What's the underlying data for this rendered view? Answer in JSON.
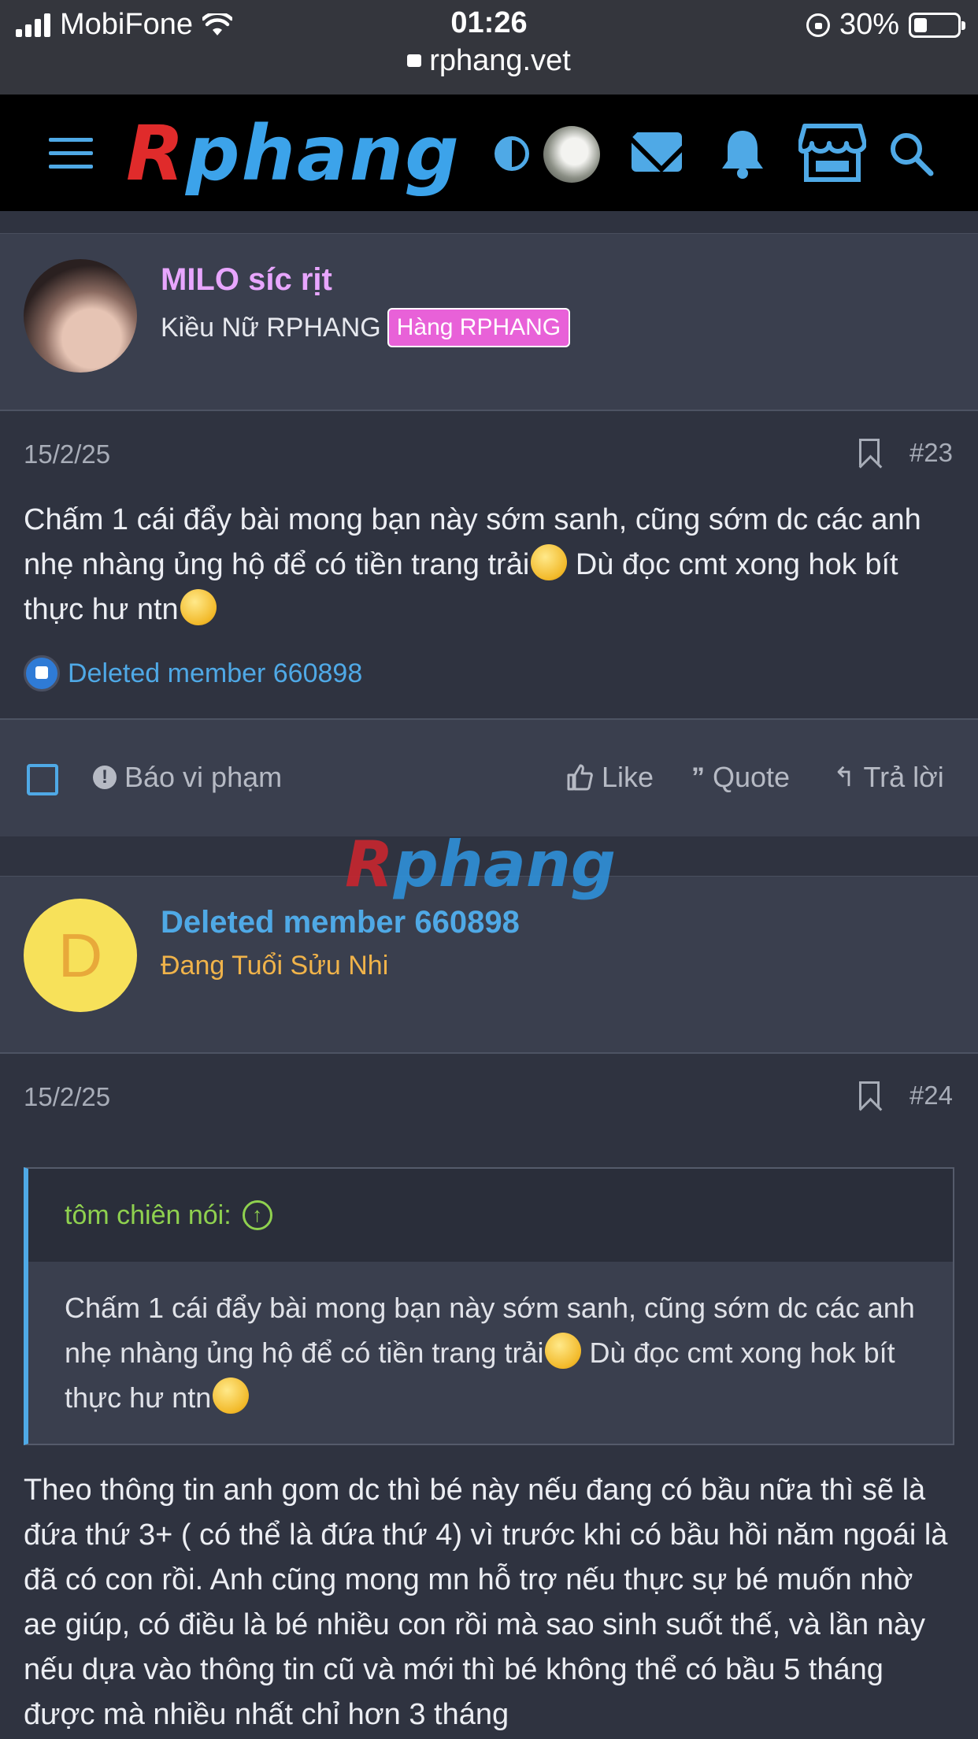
{
  "status_bar": {
    "carrier": "MobiFone",
    "time": "01:26",
    "url": "rphang.vet",
    "battery": "30%"
  },
  "header": {
    "logo_r": "R",
    "logo_rest": "phang"
  },
  "posts": [
    {
      "username": "MILO síc rịt",
      "user_title": "Kiều Nữ RPHANG",
      "badge": "Hàng RPHANG",
      "date": "15/2/25",
      "post_number": "#23",
      "message_parts": [
        "Chấm 1 cái đẩy bài mong bạn này sớm sanh, cũng sớm dc các anh nhẹ nhàng ủng hộ để có tiền trang trải",
        " Dù đọc cmt xong hok bít thực hư ntn"
      ],
      "reaction_user": "Deleted member 660898",
      "actions": {
        "report": "Báo vi phạm",
        "like": "Like",
        "quote": "Quote",
        "reply": "Trả lời"
      }
    },
    {
      "avatar_letter": "D",
      "username": "Deleted member 660898",
      "user_title": "Đang Tuổi Sửu Nhi",
      "date": "15/2/25",
      "post_number": "#24",
      "quote_author": "tôm chiên nói:",
      "quote_parts": [
        "Chấm 1 cái đẩy bài mong bạn này sớm sanh, cũng sớm dc các anh nhẹ nhàng ủng hộ để có tiền trang trải",
        " Dù đọc cmt xong hok bít thực hư ntn"
      ],
      "message": "Theo thông tin anh gom dc thì bé này nếu đang có bầu nữa thì sẽ là đứa thứ 3+ ( có thể là đứa thứ 4) vì trước khi có bầu hồi năm ngoái là đã có con rồi. Anh cũng mong mn hỗ trợ nếu thực sự bé muốn nhờ ae giúp, có điều là bé nhiều con rồi mà sao sinh suốt thế, và lần này nếu dựa vào thông tin cũ và mới thì bé không thể có bầu 5 tháng được mà nhiều nhất chỉ hơn 3 tháng"
    }
  ],
  "watermark": {
    "r": "R",
    "rest": "phang"
  },
  "colors": {
    "accent": "#4fa9e6",
    "username_purple": "#e8a6ff",
    "badge_pink": "#e861d8",
    "title_orange": "#f0b34a",
    "quote_green": "#8fd14f"
  }
}
